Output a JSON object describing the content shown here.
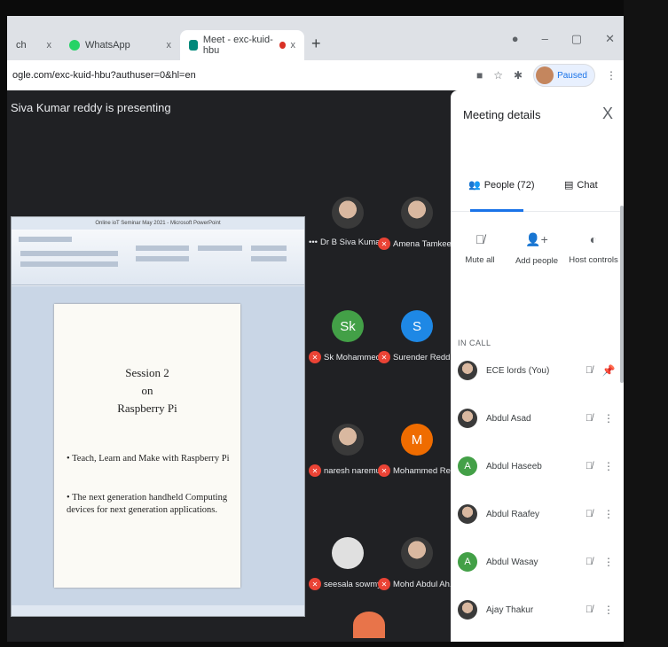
{
  "browser": {
    "tabs": [
      {
        "label": "ch",
        "active": false,
        "close": "x"
      },
      {
        "label": "WhatsApp",
        "active": false,
        "close": "x"
      },
      {
        "label": "Meet - exc-kuid-hbu",
        "active": true,
        "close": "x"
      }
    ],
    "new_tab": "+",
    "url": "ogle.com/exc-kuid-hbu?authuser=0&hl=en",
    "profile_label": "Paused"
  },
  "meeting": {
    "presenting_text": "Siva Kumar reddy is presenting",
    "slide": {
      "window_title": "Online ioT Seminar May 2021 - Microsoft PowerPoint",
      "heading_lines": [
        "Session 2",
        "on",
        "Raspberry Pi"
      ],
      "bullets": [
        "Teach, Learn and Make with Raspberry Pi",
        "The next generation handheld Computing devices for next generation applications."
      ]
    },
    "participants": [
      {
        "name": "Dr B Siva Kuma...",
        "avatar": "photo",
        "muted": false,
        "more": true
      },
      {
        "name": "Amena Tamkeen",
        "avatar": "photo",
        "muted": true
      },
      {
        "name": "Sk Mohammed ...",
        "avatar": "Sk",
        "color": "#43a047",
        "muted": true
      },
      {
        "name": "Surender Redd...",
        "avatar": "S",
        "color": "#1e88e5",
        "muted": true
      },
      {
        "name": "naresh naremulla",
        "avatar": "photo",
        "muted": true
      },
      {
        "name": "Mohammed Re...",
        "avatar": "M",
        "color": "#ef6c00",
        "muted": true
      },
      {
        "name": "seesala sowmya",
        "avatar": "photo",
        "muted": true
      },
      {
        "name": "Mohd Abdul Ah...",
        "avatar": "photo",
        "muted": true
      }
    ]
  },
  "panel": {
    "title": "Meeting details",
    "close": "X",
    "tabs": {
      "people": "People (72)",
      "chat": "Chat"
    },
    "actions": {
      "mute_all": "Mute all",
      "add_people": "Add people",
      "host_controls": "Host controls"
    },
    "in_call_label": "IN CALL",
    "people": [
      {
        "name": "ECE lords (You)",
        "avatar": "photo"
      },
      {
        "name": "Abdul Asad",
        "avatar": "photo"
      },
      {
        "name": "Abdul Haseeb",
        "avatar": "A",
        "color": "#43a047"
      },
      {
        "name": "Abdul Raafey",
        "avatar": "photo"
      },
      {
        "name": "Abdul Wasay",
        "avatar": "A",
        "color": "#43a047"
      },
      {
        "name": "Ajay Thakur",
        "avatar": "photo"
      }
    ]
  }
}
